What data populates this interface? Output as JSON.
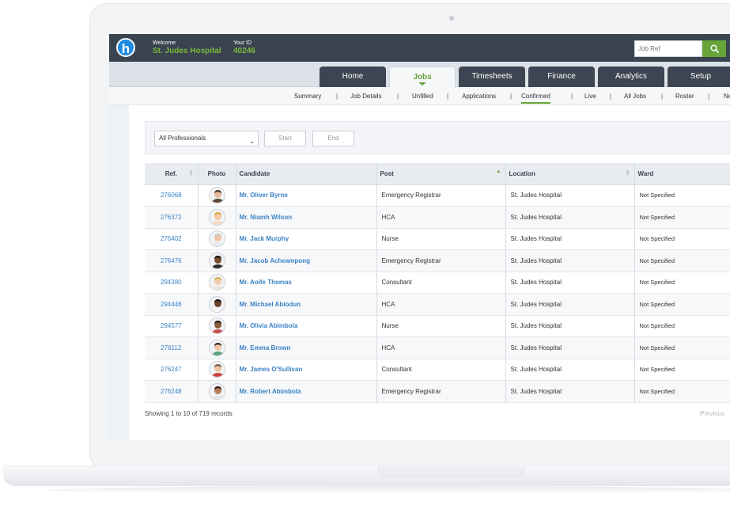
{
  "header": {
    "logo_letter": "h",
    "welcome_label": "Welcome",
    "hospital_name": "St. Judes Hospital",
    "id_label": "Your ID",
    "id_value": "40246",
    "search_placeholder": "Job Ref"
  },
  "tabs": [
    {
      "label": "Home",
      "active": false
    },
    {
      "label": "Jobs",
      "active": true
    },
    {
      "label": "Timesheets",
      "active": false
    },
    {
      "label": "Finance",
      "active": false
    },
    {
      "label": "Analytics",
      "active": false
    },
    {
      "label": "Setup",
      "active": false
    }
  ],
  "subnav": [
    "Summary",
    "Job Details",
    "Unfilled",
    "Applications",
    "Confirmed",
    "Live",
    "All Jobs",
    "Roster",
    "Ne"
  ],
  "subnav_active": "Confirmed",
  "filters": {
    "professional": "All Professionals",
    "start": "Start",
    "end": "End"
  },
  "table": {
    "columns": [
      "Ref.",
      "Photo",
      "Candidate",
      "Post",
      "Location",
      "Ward"
    ],
    "rows": [
      {
        "ref": "276068",
        "candidate": "Mr. Oliver Byrne",
        "post": "Emergency Registrar",
        "location": "St. Judes Hospital",
        "ward": "Not Specified",
        "avatar": {
          "skin": "#e8b89a",
          "hair": "#4a3a2c",
          "shirt": "#5b4636"
        }
      },
      {
        "ref": "276372",
        "candidate": "Mr. Niamh Wilson",
        "post": "HCA",
        "location": "St. Judes Hospital",
        "ward": "Not Specified",
        "avatar": {
          "skin": "#f1c9a5",
          "hair": "#d9a441",
          "shirt": "#f4d9c1"
        }
      },
      {
        "ref": "276402",
        "candidate": "Mr. Jack Murphy",
        "post": "Nurse",
        "location": "St. Judes Hospital",
        "ward": "Not Specified",
        "avatar": {
          "skin": "#efc4a6",
          "hair": "#c9c9c9",
          "shirt": "#e6e9ef"
        }
      },
      {
        "ref": "276476",
        "candidate": "Mr. Jacob Acheampong",
        "post": "Emergency Registrar",
        "location": "St. Judes Hospital",
        "ward": "Not Specified",
        "avatar": {
          "skin": "#7a4b2e",
          "hair": "#1d1410",
          "shirt": "#2e2b2a"
        }
      },
      {
        "ref": "294380",
        "candidate": "Mr. Aoife Thomas",
        "post": "Consultant",
        "location": "St. Judes Hospital",
        "ward": "Not Specified",
        "avatar": {
          "skin": "#f2ccad",
          "hair": "#d8b24d",
          "shirt": "#f0e6d8"
        }
      },
      {
        "ref": "294446",
        "candidate": "Mr. Michael Abiodun",
        "post": "HCA",
        "location": "St. Judes Hospital",
        "ward": "Not Specified",
        "avatar": {
          "skin": "#6e432a",
          "hair": "#1a1210",
          "shirt": "#f5f5f5"
        }
      },
      {
        "ref": "294577",
        "candidate": "Mr. Olivia Abimbola",
        "post": "Nurse",
        "location": "St. Judes Hospital",
        "ward": "Not Specified",
        "avatar": {
          "skin": "#8a5a3b",
          "hair": "#2a1c16",
          "shirt": "#c94f4f"
        }
      },
      {
        "ref": "276112",
        "candidate": "Mr. Emma Brown",
        "post": "HCA",
        "location": "St. Judes Hospital",
        "ward": "Not Specified",
        "avatar": {
          "skin": "#f0c7a8",
          "hair": "#3b2a22",
          "shirt": "#5aa27a"
        }
      },
      {
        "ref": "276247",
        "candidate": "Mr. James O'Sullivan",
        "post": "Consultant",
        "location": "St. Judes Hospital",
        "ward": "Not Specified",
        "avatar": {
          "skin": "#edc2a2",
          "hair": "#7d5a45",
          "shirt": "#c94040"
        }
      },
      {
        "ref": "276248",
        "candidate": "Mr.  Robert Abimbola",
        "post": "Emergency Registrar",
        "location": "St. Judes Hospital",
        "ward": "Not Specified",
        "avatar": {
          "skin": "#b97e57",
          "hair": "#2b1e18",
          "shirt": "#e8e8e8"
        }
      }
    ]
  },
  "footer": {
    "records_info": "Showing 1 to 10 of 719 records",
    "previous": "Previous"
  },
  "colors": {
    "accent_green": "#67a43a",
    "header_bg": "#3a4350",
    "link_blue": "#3a82c4",
    "logo_blue": "#1e8be0"
  },
  "icons": {
    "search_button": "search-icon",
    "select_caret": "chevron-down-icon",
    "sort": "sort-icon"
  }
}
